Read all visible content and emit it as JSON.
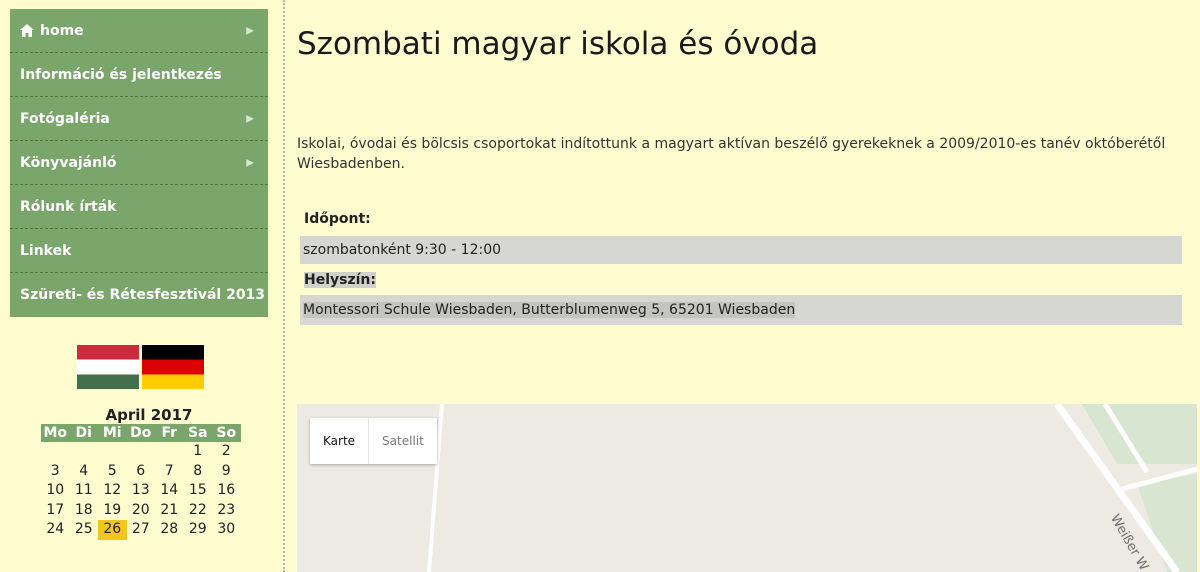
{
  "nav": {
    "items": [
      {
        "label": "home",
        "icon": "home-icon",
        "arrow": "▶"
      },
      {
        "label": "Információ és jelentkezés",
        "arrow": ""
      },
      {
        "label": "Fotógaléria",
        "arrow": "▶"
      },
      {
        "label": "Könyvajánló",
        "arrow": "▶"
      },
      {
        "label": "Rólunk írták",
        "arrow": ""
      },
      {
        "label": "Linkek",
        "arrow": ""
      },
      {
        "label": "Szüreti- és Rétesfesztivál 2013",
        "arrow": ""
      }
    ]
  },
  "flags": [
    "flag-hungary",
    "flag-germany"
  ],
  "calendar": {
    "title": "April 2017",
    "weekdays": [
      "Mo",
      "Di",
      "Mi",
      "Do",
      "Fr",
      "Sa",
      "So"
    ],
    "weeks": [
      [
        "",
        "",
        "",
        "",
        "",
        "1",
        "2"
      ],
      [
        "3",
        "4",
        "5",
        "6",
        "7",
        "8",
        "9"
      ],
      [
        "10",
        "11",
        "12",
        "13",
        "14",
        "15",
        "16"
      ],
      [
        "17",
        "18",
        "19",
        "20",
        "21",
        "22",
        "23"
      ],
      [
        "24",
        "25",
        "26",
        "27",
        "28",
        "29",
        "30"
      ]
    ],
    "today": "26",
    "highlight_color": "#f3c61c"
  },
  "main": {
    "title": "Szombati magyar iskola és óvoda",
    "intro": "Iskolai, óvodai és bölcsis csoportokat indítottunk a magyart aktívan beszélő gyerekeknek a 2009/2010-es tanév októberétől Wiesbadenben.",
    "time_label": "Időpont:",
    "time_value": "szombatonként 9:30 - 12:00",
    "location_label": "Helyszín:",
    "location_value": "Montessori Schule Wiesbaden, Butterblumenweg 5, 65201 Wiesbaden"
  },
  "map": {
    "btn_map": "Karte",
    "btn_satellite": "Satellit",
    "street_label": "Weißer W"
  },
  "colors": {
    "background": "#fffdd0",
    "nav_green": "#7aa66b",
    "info_gray": "#d6d6d2"
  }
}
